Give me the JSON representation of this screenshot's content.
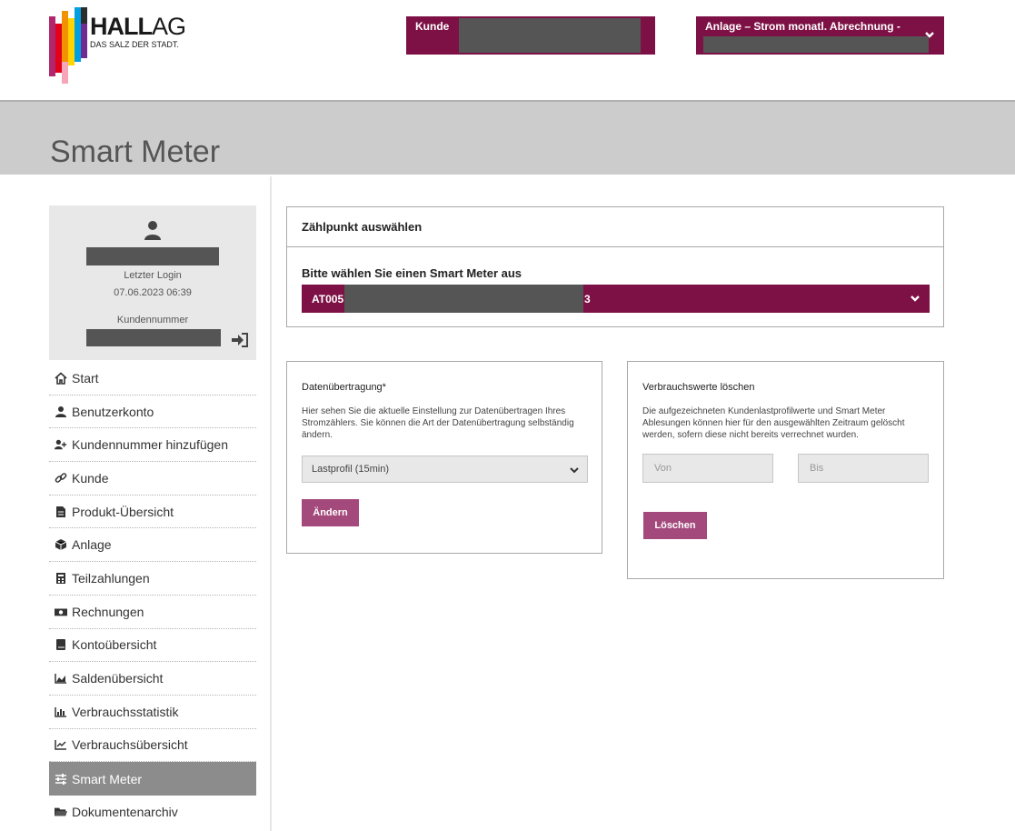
{
  "brand": {
    "name_bold": "HALL",
    "name_light": "AG",
    "tagline": "DAS SALZ DER STADT."
  },
  "header": {
    "kunde_label": "Kunde",
    "anlage_label": "Anlage  –  Strom monatl. Abrechnung -"
  },
  "page_title": "Smart Meter",
  "user_card": {
    "last_login_label": "Letzter Login",
    "last_login_value": "07.06.2023 06:39",
    "customer_number_label": "Kundennummer"
  },
  "nav": {
    "items": [
      {
        "label": "Start",
        "icon": "home-icon"
      },
      {
        "label": "Benutzerkonto",
        "icon": "user-icon"
      },
      {
        "label": "Kundennummer hinzufügen",
        "icon": "user-plus-icon"
      },
      {
        "label": "Kunde",
        "icon": "link-icon"
      },
      {
        "label": "Produkt-Übersicht",
        "icon": "document-icon"
      },
      {
        "label": "Anlage",
        "icon": "cube-icon"
      },
      {
        "label": "Teilzahlungen",
        "icon": "calculator-icon"
      },
      {
        "label": "Rechnungen",
        "icon": "money-icon"
      },
      {
        "label": "Kontoübersicht",
        "icon": "book-icon"
      },
      {
        "label": "Saldenübersicht",
        "icon": "area-chart-icon"
      },
      {
        "label": "Verbrauchsstatistik",
        "icon": "bar-chart-icon"
      },
      {
        "label": "Verbrauchsübersicht",
        "icon": "line-chart-icon"
      },
      {
        "label": "Smart Meter",
        "icon": "sliders-icon"
      },
      {
        "label": "Dokumentenarchiv",
        "icon": "folder-icon"
      }
    ],
    "active_label": "Smart Meter"
  },
  "zaehlpunkt": {
    "heading": "Zählpunkt auswählen",
    "select_label": "Bitte wählen Sie einen Smart Meter aus",
    "value_prefix": "AT005",
    "value_suffix": "3"
  },
  "datenuebertragung": {
    "title": "Datenübertragung*",
    "description": "Hier sehen Sie die aktuelle Einstellung zur Datenübertragen Ihres Stromzählers. Sie können die Art der Datenübertragung selbständig ändern.",
    "selected": "Lastprofil (15min)",
    "button": "Ändern"
  },
  "verbrauchswerte": {
    "title": "Verbrauchswerte löschen",
    "description": "Die aufgezeichneten Kundenlastprofilwerte und Smart Meter Ablesungen können hier für den ausgewählten Zeitraum gelöscht werden, sofern diese nicht bereits verrechnet wurden.",
    "from_placeholder": "Von",
    "to_placeholder": "Bis",
    "button": "Löschen"
  },
  "colors": {
    "brand_primary": "#7d1146",
    "button": "#a4497b",
    "title_band": "#cccccc",
    "nav_active": "#8c8c8c"
  }
}
